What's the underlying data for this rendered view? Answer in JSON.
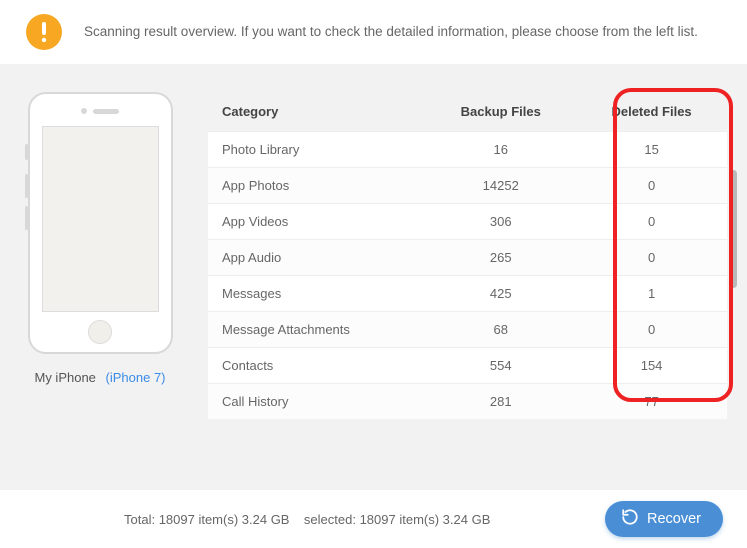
{
  "banner": {
    "text": "Scanning result overview. If you want to check the detailed information, please choose from the left list."
  },
  "device": {
    "name": "My iPhone",
    "model": "(iPhone 7)"
  },
  "table": {
    "headers": {
      "category": "Category",
      "backup": "Backup Files",
      "deleted": "Deleted Files"
    },
    "rows": [
      {
        "category": "Photo Library",
        "backup": "16",
        "deleted": "15"
      },
      {
        "category": "App Photos",
        "backup": "14252",
        "deleted": "0"
      },
      {
        "category": "App Videos",
        "backup": "306",
        "deleted": "0"
      },
      {
        "category": "App Audio",
        "backup": "265",
        "deleted": "0"
      },
      {
        "category": "Messages",
        "backup": "425",
        "deleted": "1"
      },
      {
        "category": "Message Attachments",
        "backup": "68",
        "deleted": "0"
      },
      {
        "category": "Contacts",
        "backup": "554",
        "deleted": "154"
      },
      {
        "category": "Call History",
        "backup": "281",
        "deleted": "77"
      }
    ]
  },
  "footer": {
    "status_prefix_total": "Total: ",
    "total": "18097 item(s) 3.24 GB",
    "status_prefix_sel": "    selected: ",
    "selected": "18097 item(s) 3.24 GB",
    "recover_label": "Recover"
  }
}
